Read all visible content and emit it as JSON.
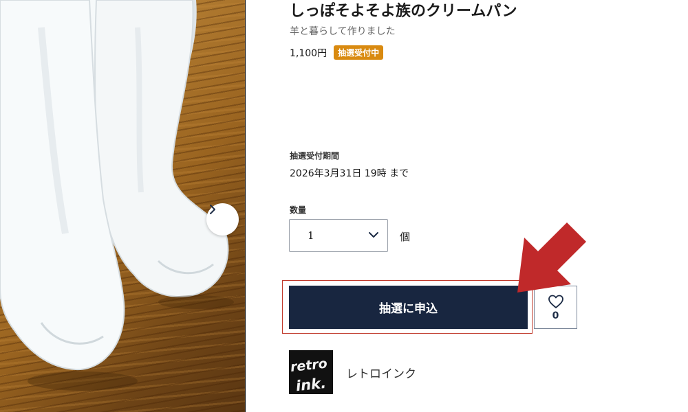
{
  "product": {
    "title": "しっぽそよそよ族のクリームパン",
    "subtitle": "羊と暮らして作りました",
    "price": "1,100円",
    "status_badge": "抽選受付中"
  },
  "lottery": {
    "period_label": "抽選受付期間",
    "period_value": "2026年3月31日 19時 まで"
  },
  "quantity": {
    "label": "数量",
    "value": "1",
    "unit": "個"
  },
  "actions": {
    "apply_label": "抽選に申込",
    "like_count": "0"
  },
  "shop": {
    "name": "レトロインク",
    "logo_text": "retro ink."
  },
  "colors": {
    "primary": "#182640",
    "badge": "#d98a10",
    "annotation_arrow": "#c0292a"
  },
  "icons": {
    "next": "chevron-right-icon",
    "dropdown": "chevron-down-icon",
    "like": "heart-icon"
  }
}
